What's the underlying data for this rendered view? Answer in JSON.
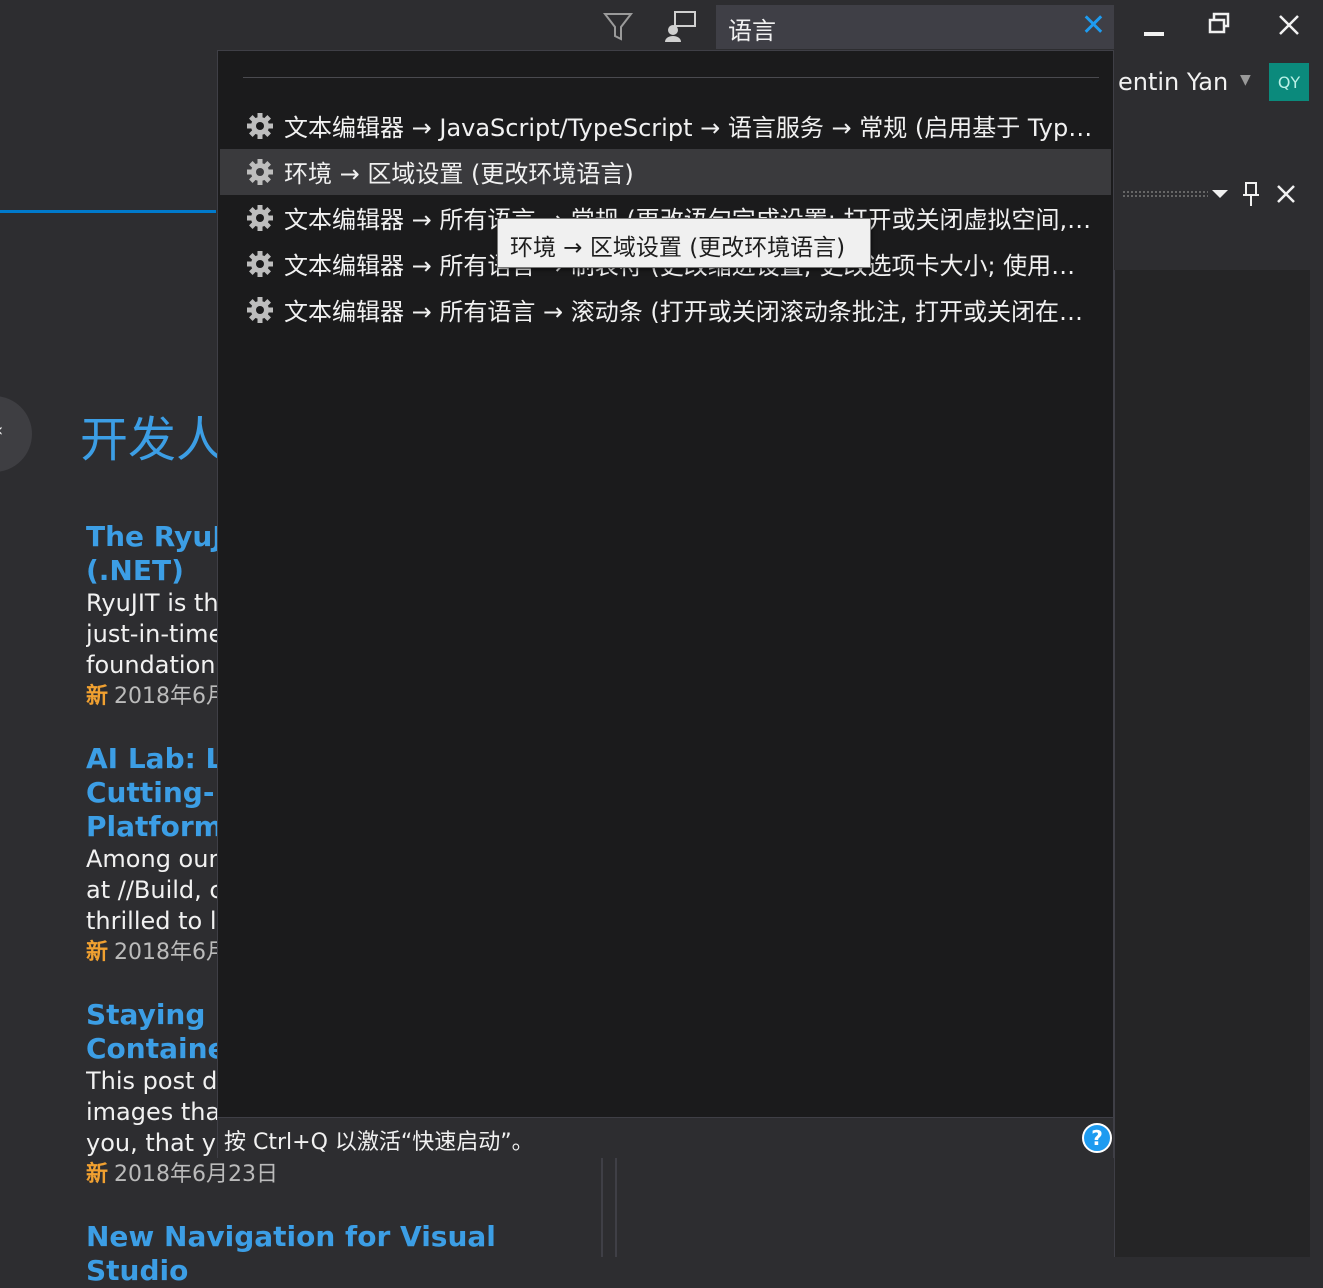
{
  "titlebar": {
    "search_value": "语言",
    "icons": [
      "filter-icon",
      "feedback-icon"
    ],
    "window_buttons": [
      "minimize",
      "restore",
      "close"
    ]
  },
  "account": {
    "name": "entin Yan",
    "initials": "QY",
    "avatar_color": "#0b8a7c"
  },
  "start_page": {
    "heading": "开发人",
    "news": [
      {
        "title": "The RyuJI\n(.NET)",
        "desc": "RyuJIT is th\njust-in-time\nfoundationa",
        "badge": "新",
        "date": "2018年6月"
      },
      {
        "title": "AI Lab: Le\nCutting-Ed\nPlatform",
        "desc": "Among our\nat //Build, c\nthrilled to la",
        "badge": "新",
        "date": "2018年6月"
      },
      {
        "title": "Staying up\nContainer",
        "desc": "This post de\nimages that\nyou, that yo",
        "badge": "新",
        "date": "2018年6月23日"
      },
      {
        "title": "New Navigation for Visual Studio",
        "desc": "",
        "badge": "",
        "date": ""
      }
    ]
  },
  "quick_launch": {
    "results": [
      {
        "text": "文本编辑器 → JavaScript/TypeScript → 语言服务 → 常规 (启用基于 Typ…",
        "selected": false
      },
      {
        "text": "环境 → 区域设置 (更改环境语言)",
        "selected": true
      },
      {
        "text": "文本编辑器 → 所有语言 → 常规 (更改语句完成设置; 打开或关闭虚拟空间,…",
        "selected": false
      },
      {
        "text": "文本编辑器 → 所有语言 → 制表符 (更改缩进设置; 更改选项卡大小; 使用…",
        "selected": false
      },
      {
        "text": "文本编辑器 → 所有语言 → 滚动条 (打开或关闭滚动条批注, 打开或关闭在…",
        "selected": false
      }
    ],
    "tooltip": "环境 → 区域设置 (更改环境语言)",
    "footer_hint": "按 Ctrl+Q 以激活“快速启动”。",
    "accent_color": "#1e9bf0"
  }
}
